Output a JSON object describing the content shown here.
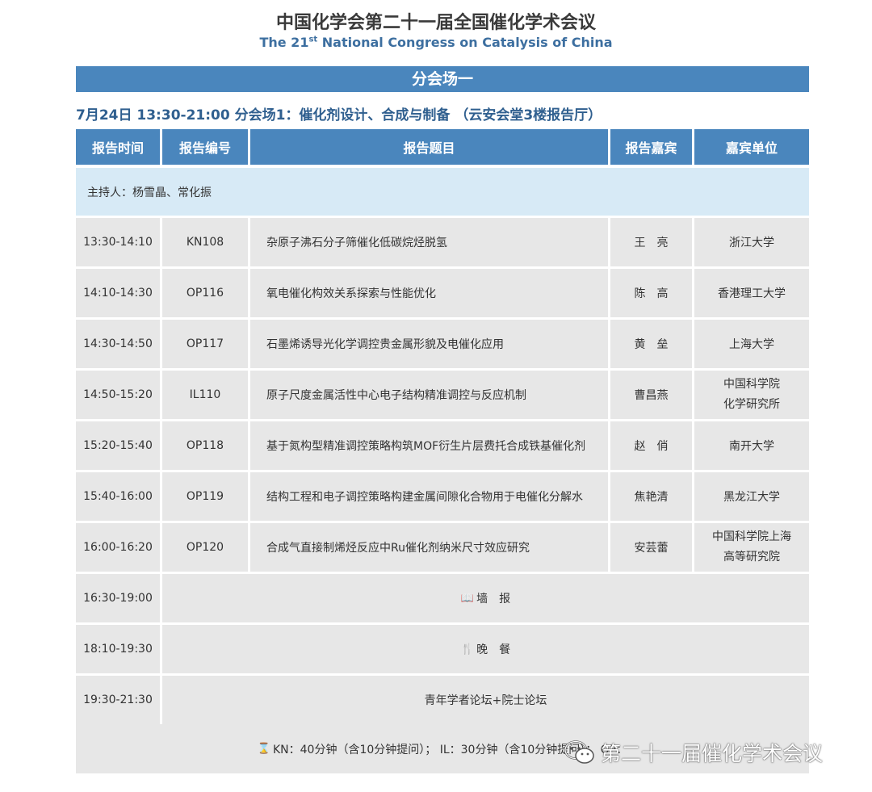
{
  "header": {
    "title_cn": "中国化学会第二十一届全国催化学术会议",
    "title_en_pre": "The 21",
    "title_en_sup": "st",
    "title_en_post": " National Congress on Catalysis of China"
  },
  "band": {
    "label": "分会场一"
  },
  "session": {
    "label": "7月24日  13:30-21:00  分会场1：催化剂设计、合成与制备  （云安会堂3楼报告厅）"
  },
  "table": {
    "headers": [
      "报告时间",
      "报告编号",
      "报告题目",
      "报告嘉宾",
      "嘉宾单位"
    ],
    "host": "主持人：杨雪晶、常化振",
    "rows": [
      {
        "time": "13:30-14:10",
        "code": "KN108",
        "title": "杂原子沸石分子筛催化低碳烷烃脱氢",
        "speaker": "王　亮",
        "org1": "浙江大学",
        "org2": ""
      },
      {
        "time": "14:10-14:30",
        "code": "OP116",
        "title": "氧电催化构效关系探索与性能优化",
        "speaker": "陈　高",
        "org1": "香港理工大学",
        "org2": ""
      },
      {
        "time": "14:30-14:50",
        "code": "OP117",
        "title": "石墨烯诱导光化学调控贵金属形貌及电催化应用",
        "speaker": "黄　垒",
        "org1": "上海大学",
        "org2": ""
      },
      {
        "time": "14:50-15:20",
        "code": "IL110",
        "title": "原子尺度金属活性中心电子结构精准调控与反应机制",
        "speaker": "曹昌燕",
        "org1": "中国科学院",
        "org2": "化学研究所"
      },
      {
        "time": "15:20-15:40",
        "code": "OP118",
        "title": "基于氮构型精准调控策略构筑MOF衍生片层费托合成铁基催化剂",
        "speaker": "赵　俏",
        "org1": "南开大学",
        "org2": ""
      },
      {
        "time": "15:40-16:00",
        "code": "OP119",
        "title": "结构工程和电子调控策略构建金属间隙化合物用于电催化分解水",
        "speaker": "焦艳清",
        "org1": "黑龙江大学",
        "org2": ""
      },
      {
        "time": "16:00-16:20",
        "code": "OP120",
        "title": "合成气直接制烯烃反应中Ru催化剂纳米尺寸效应研究",
        "speaker": "安芸蕾",
        "org1": "中国科学院上海",
        "org2": "高等研究院"
      }
    ],
    "events": [
      {
        "time": "16:30-19:00",
        "icon": "book-icon",
        "glyph": "📖",
        "label": "墙　报"
      },
      {
        "time": "18:10-19:30",
        "icon": "fork-knife-icon",
        "glyph": "🍴",
        "label": "晚　餐"
      },
      {
        "time": "19:30-21:30",
        "icon": "",
        "glyph": "",
        "label": "青年学者论坛+院士论坛"
      }
    ]
  },
  "footnote": {
    "icon": "hourglass-icon",
    "glyph": "⌛",
    "text": "KN：40分钟（含10分钟提问）； IL：30分钟（含10分钟提问）； OP："
  },
  "watermark": {
    "icon": "wechat-icon",
    "text": "第二十一届催化学术会议"
  }
}
